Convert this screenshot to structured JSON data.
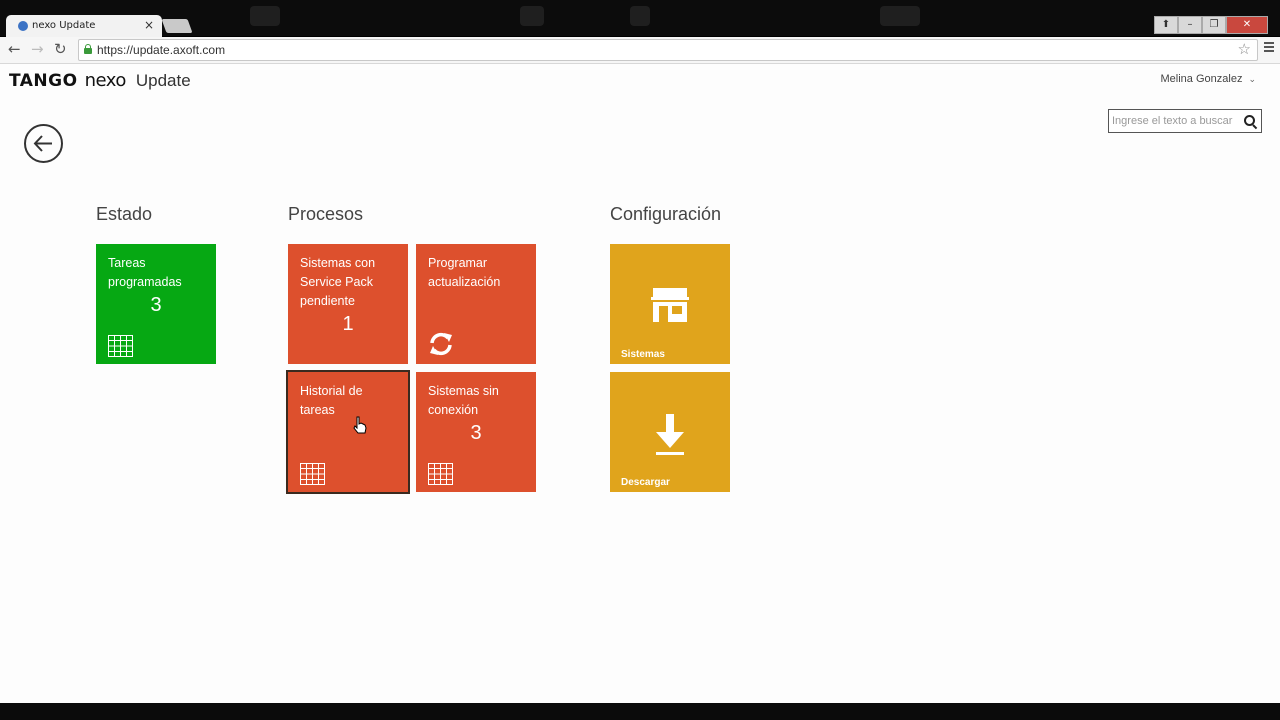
{
  "browser": {
    "tab_title": "nexo Update",
    "tab_close": "×",
    "url": "https://update.axoft.com",
    "window_buttons": [
      "⬆",
      "–",
      "❐",
      "✕"
    ]
  },
  "header": {
    "logo_tango": "TANGO",
    "logo_nexo": "nexo",
    "app_name": "Update",
    "user_name": "Melina Gonzalez",
    "search_placeholder": "Ingrese el texto a buscar"
  },
  "sections": {
    "estado": {
      "title": "Estado"
    },
    "procesos": {
      "title": "Procesos"
    },
    "configuracion": {
      "title": "Configuración"
    }
  },
  "tiles": {
    "tareas_programadas": {
      "label": "Tareas programadas",
      "count": "3",
      "color": "#06a813",
      "icon": "grid-icon"
    },
    "service_pack": {
      "label": "Sistemas con Service Pack pendiente",
      "count": "1",
      "color": "#dd502d"
    },
    "programar": {
      "label": "Programar actualización",
      "color": "#dd502d",
      "icon": "refresh-icon"
    },
    "historial": {
      "label": "Historial de tareas",
      "color": "#dd502d",
      "icon": "grid-icon",
      "selected": true
    },
    "sin_conexion": {
      "label": "Sistemas sin conexión",
      "count": "3",
      "color": "#dd502d",
      "icon": "grid-icon"
    },
    "sistemas": {
      "label": "Sistemas",
      "color": "#e0a41c",
      "icon": "store-icon"
    },
    "descargar": {
      "label": "Descargar",
      "color": "#e0a41c",
      "icon": "download-icon"
    }
  }
}
